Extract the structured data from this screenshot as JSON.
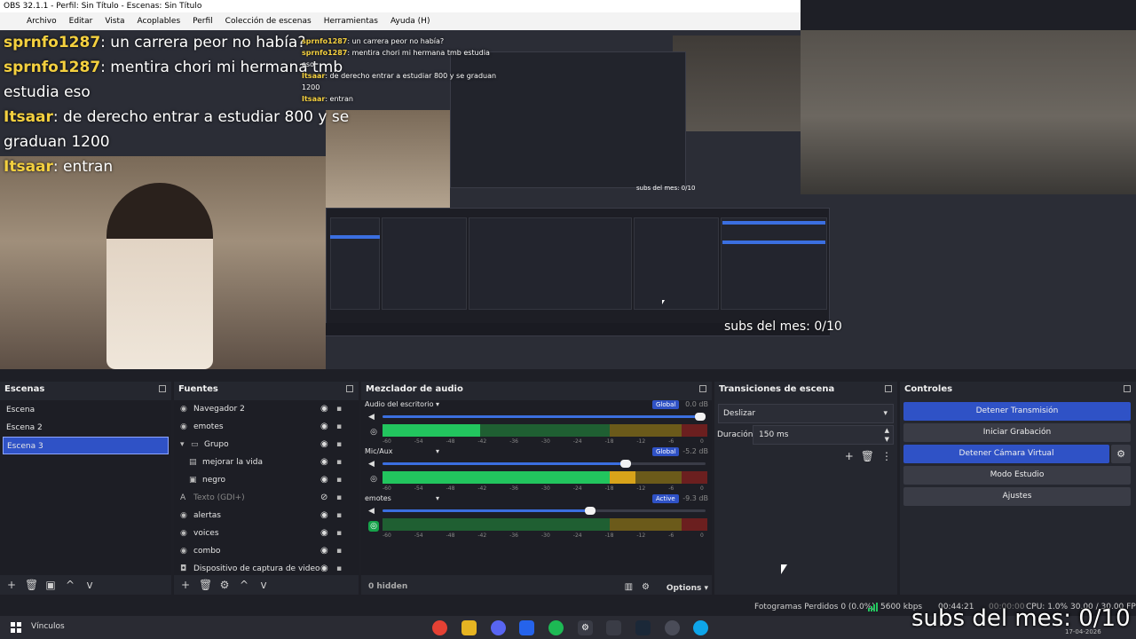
{
  "window": {
    "title": "OBS 32.1.1 - Perfil: Sin Título - Escenas: Sin Título",
    "menu": [
      "Archivo",
      "Editar",
      "Vista",
      "Acoplables",
      "Perfil",
      "Colección de escenas",
      "Herramientas",
      "Ayuda (H)"
    ]
  },
  "preview": {
    "chat": [
      {
        "user": "sprnfo1287",
        "text": ": un carrera peor no había?"
      },
      {
        "user": "sprnfo1287",
        "text": ": mentira chori mi hermana tmb estudia eso"
      },
      {
        "user": "Itsaar",
        "text": ": de derecho entrar a estudiar 800 y se graduan 1200"
      },
      {
        "user": "Itsaar",
        "text": ": entran"
      }
    ],
    "subs_text": "subs del mes: 0/10",
    "subs_mini": "subs del mes: 0/10"
  },
  "scenes": {
    "title": "Escenas",
    "items": [
      "Escena",
      "Escena 2",
      "Escena 3"
    ],
    "selected_index": 2,
    "toolbar": [
      "+",
      "🗑",
      "▣",
      "^",
      "v"
    ]
  },
  "sources": {
    "title": "Fuentes",
    "items": [
      {
        "label": "Navegador 2",
        "icon": "globe-icon",
        "indent": 0,
        "dim": false
      },
      {
        "label": "emotes",
        "icon": "globe-icon",
        "indent": 0,
        "dim": false
      },
      {
        "label": "Grupo",
        "icon": "folder-icon",
        "indent": 0,
        "dim": false
      },
      {
        "label": "mejorar la vida",
        "icon": "bars-icon",
        "indent": 1,
        "dim": false
      },
      {
        "label": "negro",
        "icon": "image-icon",
        "indent": 1,
        "dim": false
      },
      {
        "label": "Texto (GDI+)",
        "icon": "text-icon",
        "indent": 0,
        "dim": true
      },
      {
        "label": "alertas",
        "icon": "globe-icon",
        "indent": 0,
        "dim": false
      },
      {
        "label": "voices",
        "icon": "globe-icon",
        "indent": 0,
        "dim": false
      },
      {
        "label": "combo",
        "icon": "globe-icon",
        "indent": 0,
        "dim": false
      },
      {
        "label": "Dispositivo de captura de video",
        "icon": "camera-icon",
        "indent": 0,
        "dim": false
      }
    ],
    "toolbar": [
      "+",
      "🗑",
      "⚙",
      "^",
      "v"
    ]
  },
  "mixer": {
    "title": "Mezclador de audio",
    "channels": [
      {
        "name": "Audio del escritorio",
        "badge": "Global",
        "db": "0.0 dB",
        "volume": 1.0,
        "level": 0.3,
        "monitor": false
      },
      {
        "name": "Mic/Aux",
        "badge": "Global",
        "db": "-5.2 dB",
        "volume": 0.77,
        "level": 0.78,
        "monitor": false
      },
      {
        "name": "emotes",
        "badge": "Active",
        "db": "-9.3 dB",
        "volume": 0.66,
        "level": 0.0,
        "monitor": true
      }
    ],
    "scale": [
      "-60",
      "-54",
      "-48",
      "-42",
      "-36",
      "-30",
      "-24",
      "-18",
      "-12",
      "-6",
      "0"
    ],
    "hidden": "0 hidden",
    "options": "Options"
  },
  "transitions": {
    "title": "Transiciones de escena",
    "selected": "Deslizar",
    "duration_label": "Duración",
    "duration": "150 ms"
  },
  "controls": {
    "title": "Controles",
    "buttons": [
      {
        "label": "Detener Transmisión",
        "primary": true
      },
      {
        "label": "Iniciar Grabación",
        "primary": false
      },
      {
        "label": "Detener Cámara Virtual",
        "primary": true
      },
      {
        "label": "Modo Estudio",
        "primary": false
      },
      {
        "label": "Ajustes",
        "primary": false
      }
    ]
  },
  "status": {
    "dropped": "Fotogramas Perdidos 0 (0.0%)",
    "bitrate": "5600 kbps",
    "stream_time": "00:44:21",
    "rec_time": "00:00:00",
    "cpu": "CPU: 1.0%",
    "fps": "30.00 / 30.00 FPS"
  },
  "taskbar": {
    "label": "Vínculos",
    "date": "17-04-2026",
    "overlay": "subs del mes: 0/10"
  },
  "colors": {
    "accent": "#2f52c6",
    "meter_green": "#22c55e",
    "meter_yellow": "#d8a31a",
    "meter_red": "#b91c1c"
  }
}
